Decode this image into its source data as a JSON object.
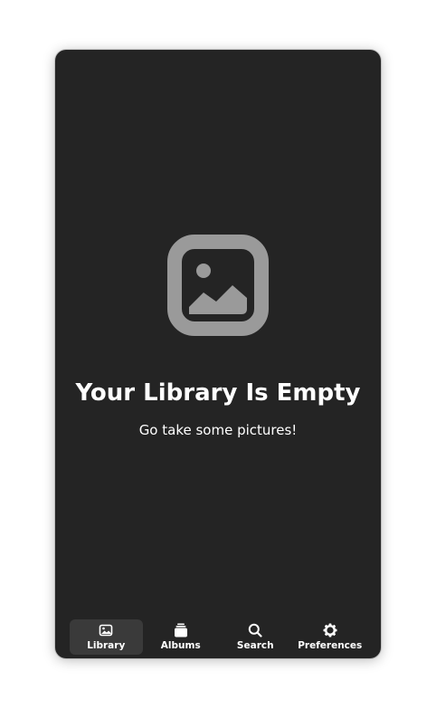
{
  "empty_state": {
    "icon": "image-icon",
    "title": "Your Library Is Empty",
    "subtitle": "Go take some pictures!"
  },
  "tabs": [
    {
      "label": "Library",
      "icon": "library-icon",
      "active": true
    },
    {
      "label": "Albums",
      "icon": "albums-icon",
      "active": false
    },
    {
      "label": "Search",
      "icon": "search-icon",
      "active": false
    },
    {
      "label": "Preferences",
      "icon": "gear-icon",
      "active": false
    }
  ],
  "colors": {
    "background": "#242424",
    "text": "#ffffff",
    "icon_dim": "#9a9a9a",
    "active_tab": "#3a3a3a"
  }
}
